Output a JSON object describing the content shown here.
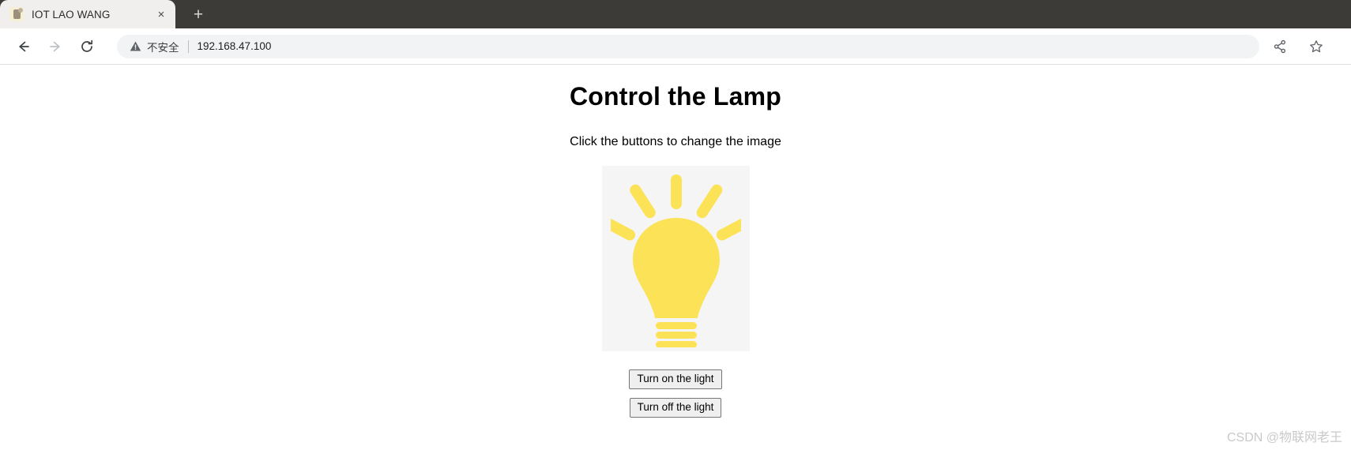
{
  "browser": {
    "tab": {
      "title": "IOT LAO WANG",
      "close_label": "×",
      "favicon_name": "site-favicon"
    },
    "new_tab_label": "+",
    "toolbar": {
      "back_label": "back",
      "forward_label": "forward",
      "reload_label": "reload",
      "share_label": "share",
      "bookmark_label": "bookmark"
    },
    "omnibox": {
      "security_text": "不安全",
      "url": "192.168.47.100",
      "warning_icon": "warning-triangle-icon"
    }
  },
  "page": {
    "heading": "Control the Lamp",
    "subtitle": "Click the buttons to change the image",
    "lamp_image_name": "lightbulb-on-image",
    "lamp_color": "#FCE257",
    "lamp_bg": "#F5F5F5",
    "buttons": {
      "turn_on": "Turn on the light",
      "turn_off": "Turn off the light"
    }
  },
  "watermark": "CSDN @物联网老王"
}
